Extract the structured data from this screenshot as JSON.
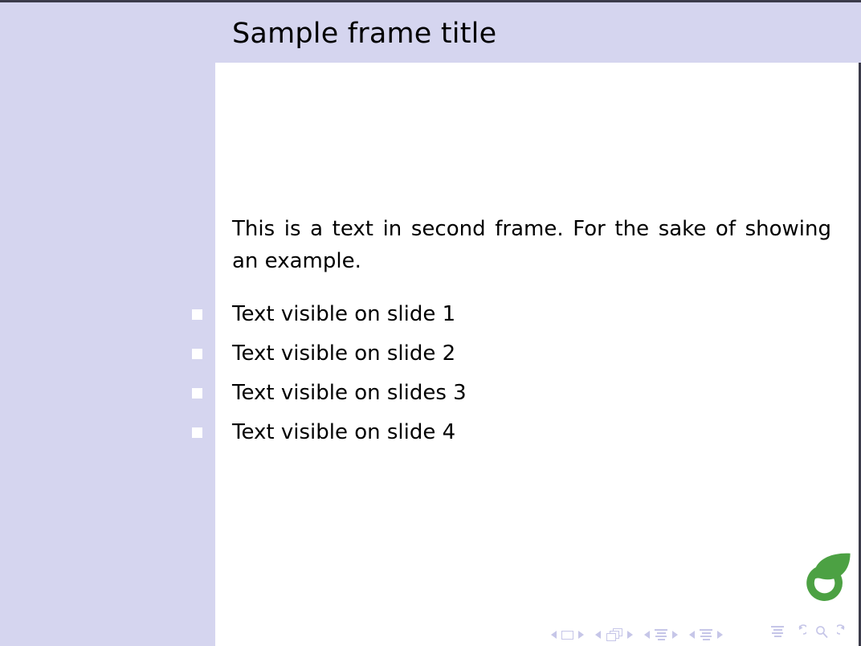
{
  "slide": {
    "title": "Sample frame title",
    "intro_paragraph": "This is a text in second frame. For the sake of showing an example.",
    "bullets": [
      {
        "label": "Text visible on slide 1",
        "marker": "square-bullet-icon"
      },
      {
        "label": "Text visible on slide 2",
        "marker": "square-bullet-icon"
      },
      {
        "label": "Text visible on slides 3",
        "marker": "square-bullet-icon"
      },
      {
        "label": "Text visible on slide 4",
        "marker": "square-bullet-icon"
      }
    ]
  },
  "navigation": {
    "groups": [
      {
        "name": "slide-navigation",
        "prev": "prev-slide-icon",
        "glyph": "slide-icon",
        "next": "next-slide-icon"
      },
      {
        "name": "frame-navigation",
        "prev": "prev-frame-icon",
        "glyph": "frame-icon",
        "next": "next-frame-icon"
      },
      {
        "name": "subsection-navigation",
        "prev": "prev-subsection-icon",
        "glyph": "subsection-icon",
        "next": "next-subsection-icon"
      },
      {
        "name": "section-navigation",
        "prev": "prev-section-icon",
        "glyph": "section-icon",
        "next": "next-section-icon"
      }
    ],
    "extra": [
      {
        "name": "document-icon",
        "symbol": "doc"
      },
      {
        "name": "back-icon",
        "symbol": "↶"
      },
      {
        "name": "search-icon",
        "symbol": "⚲"
      },
      {
        "name": "forward-icon",
        "symbol": "↷"
      }
    ]
  },
  "logo": {
    "name": "overleaf-leaf-logo",
    "color": "#4CA143"
  },
  "colors": {
    "sidebar": "#d5d5ef",
    "title_band": "#d5d5ef",
    "content_background": "#ffffff",
    "text": "#000000",
    "navigation": "#c6c6e8",
    "border": "#3b3b4a"
  }
}
